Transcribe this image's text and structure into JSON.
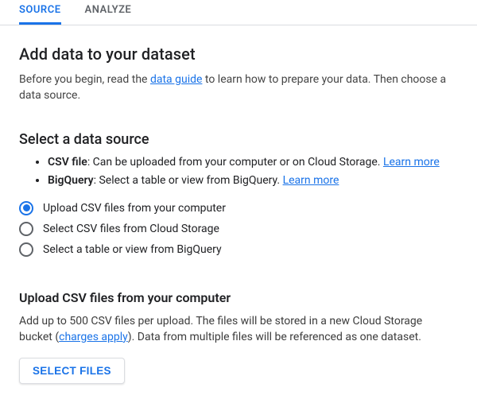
{
  "tabs": {
    "source": "SOURCE",
    "analyze": "ANALYZE"
  },
  "header": {
    "title": "Add data to your dataset",
    "intro_before": "Before you begin, read the ",
    "intro_link": "data guide",
    "intro_after": " to learn how to prepare your data. Then choose a data source."
  },
  "source_section": {
    "title": "Select a data source",
    "items": [
      {
        "name": "CSV file",
        "desc": ": Can be uploaded from your computer or on Cloud Storage. ",
        "more": "Learn more"
      },
      {
        "name": "BigQuery",
        "desc": ": Select a table or view from BigQuery. ",
        "more": "Learn more"
      }
    ],
    "radios": [
      {
        "label": "Upload CSV files from your computer",
        "selected": true
      },
      {
        "label": "Select CSV files from Cloud Storage",
        "selected": false
      },
      {
        "label": "Select a table or view from BigQuery",
        "selected": false
      }
    ]
  },
  "upload_section": {
    "title": "Upload CSV files from your computer",
    "desc_before": "Add up to 500 CSV files per upload. The files will be stored in a new Cloud Storage bucket (",
    "charges_link": "charges apply",
    "desc_after": "). Data from multiple files will be referenced as one dataset.",
    "button": "SELECT FILES"
  }
}
